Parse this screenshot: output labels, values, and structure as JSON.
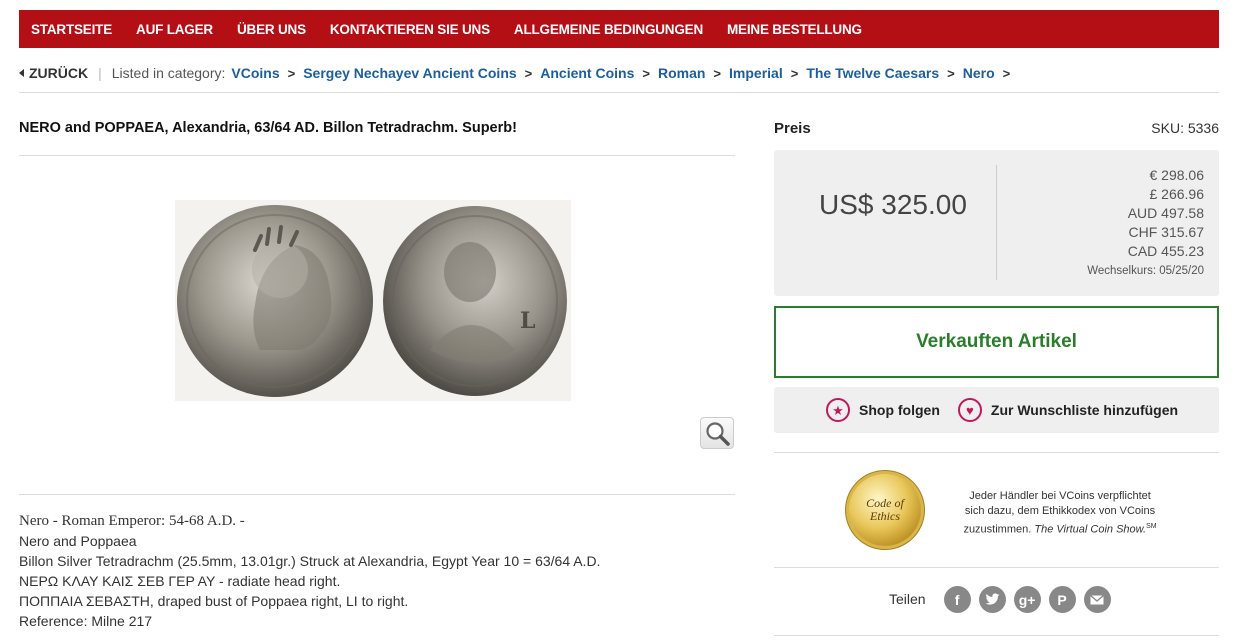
{
  "nav": {
    "items": [
      "STARTSEITE",
      "AUF LAGER",
      "ÜBER UNS",
      "KONTAKTIEREN SIE UNS",
      "ALLGEMEINE BEDINGUNGEN",
      "MEINE BESTELLUNG"
    ]
  },
  "breadcrumb": {
    "back_label": "ZURÜCK",
    "listed_label": "Listed in category:",
    "items": [
      "VCoins",
      "Sergey Nechayev Ancient Coins",
      "Ancient Coins",
      "Roman",
      "Imperial",
      "The Twelve Caesars",
      "Nero"
    ]
  },
  "product": {
    "title": "NERO and POPPAEA, Alexandria, 63/64 AD. Billon Tetradrachm. Superb!",
    "description": [
      "Nero - Roman Emperor: 54-68 A.D. -",
      "Nero and Poppaea",
      "Billon Silver Tetradrachm (25.5mm, 13.01gr.) Struck at Alexandria, Egypt Year 10 = 63/64 A.D.",
      "ΝΕΡΩ ΚΛΑΥ ΚΑΙΣ ΣΕΒ ΓΕΡ ΑΥ - radiate head right.",
      "ΠΟΠΠΑΙΑ ΣΕΒΑΣΤΗ, draped bust of Poppaea right, LI to right.",
      "Reference: Milne 217"
    ]
  },
  "pricing": {
    "label": "Preis",
    "sku": "SKU: 5336",
    "main_price": "US$ 325.00",
    "conversions": [
      "€ 298.06",
      "£ 266.96",
      "AUD 497.58",
      "CHF 315.67",
      "CAD 455.23"
    ],
    "rate_date": "Wechselkurs: 05/25/20"
  },
  "status": {
    "sold_label": "Verkauften Artikel"
  },
  "actions": {
    "follow_label": "Shop folgen",
    "wishlist_label": "Zur Wunschliste hinzufügen"
  },
  "ethics": {
    "seal_line1": "Code of",
    "seal_line2": "Ethics",
    "text": "Jeder Händler bei VCoins verpflichtet sich dazu, dem Ethikkodex von VCoins zuzustimmen.",
    "show_name": "The Virtual Coin Show.",
    "show_mark": "SM"
  },
  "share": {
    "label": "Teilen",
    "icons": [
      "facebook-icon",
      "twitter-icon",
      "google-plus-icon",
      "pinterest-icon",
      "email-icon"
    ]
  },
  "colors": {
    "nav_bg": "#b30f15",
    "link": "#1c5e9c",
    "sold_green": "#2b7d2b",
    "accent_pink": "#c2185b"
  }
}
